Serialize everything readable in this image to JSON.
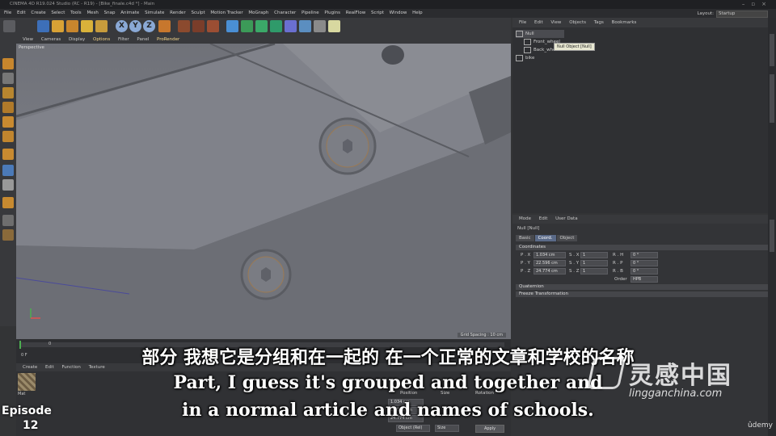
{
  "window": {
    "title": "CINEMA 4D R19.024 Studio (RC - R19) - [Bike_finale.c4d *] - Main"
  },
  "menu": {
    "items": [
      "File",
      "Edit",
      "Create",
      "Select",
      "Tools",
      "Mesh",
      "Snap",
      "Animate",
      "Simulate",
      "Render",
      "Sculpt",
      "Motion Tracker",
      "MoGraph",
      "Character",
      "Pipeline",
      "Plugins",
      "RealFlow",
      "Script",
      "Window",
      "Help"
    ],
    "layout_label": "Layout:",
    "layout_value": "Startup"
  },
  "toolbar": {
    "axis_x": "X",
    "axis_y": "Y",
    "axis_z": "Z"
  },
  "viewport": {
    "menu": [
      "View",
      "Cameras",
      "Display",
      "Options",
      "Filter",
      "Panel",
      "ProRender"
    ],
    "camera_label": "Perspective",
    "grid_spacing": "Grid Spacing : 10 cm"
  },
  "timeline": {
    "frame_start": "0 F",
    "frame_current": "0"
  },
  "material_manager": {
    "menu": [
      "Create",
      "Edit",
      "Function",
      "Texture"
    ],
    "material_name": "Mat",
    "coord_header_position": "Position",
    "coord_header_size": "Size",
    "coord_header_rotation": "Rotation",
    "x_value": "1.034 cm",
    "y_value": "22.596 cm",
    "z_value": "24.774 cm",
    "object_rel": "Object (Rel)",
    "size": "Size",
    "apply": "Apply"
  },
  "object_manager": {
    "menu": [
      "File",
      "Edit",
      "View",
      "Objects",
      "Tags",
      "Bookmarks"
    ],
    "objects": [
      {
        "name": "Null",
        "selected": true
      },
      {
        "name": "Front_wheel",
        "selected": false
      },
      {
        "name": "Back_wheel",
        "selected": false
      },
      {
        "name": "bike",
        "selected": false
      }
    ],
    "tooltip": "Null Object [Null]"
  },
  "attribute_manager": {
    "menu": [
      "Mode",
      "Edit",
      "User Data"
    ],
    "object_header": "Null [Null]",
    "tabs": [
      "Basic",
      "Coord.",
      "Object"
    ],
    "active_tab": "Coord.",
    "section_coordinates": "Coordinates",
    "rows": [
      {
        "p_label": "P . X",
        "p_value": "1.034 cm",
        "s_label": "S . X",
        "s_value": "1",
        "r_label": "R . H",
        "r_value": "0 °"
      },
      {
        "p_label": "P . Y",
        "p_value": "22.596 cm",
        "s_label": "S . Y",
        "s_value": "1",
        "r_label": "R . P",
        "r_value": "0 °"
      },
      {
        "p_label": "P . Z",
        "p_value": "24.774 cm",
        "s_label": "S . Z",
        "s_value": "1",
        "r_label": "R . B",
        "r_value": "0 °"
      }
    ],
    "order_label": "Order",
    "order_value": "HPB",
    "section_quaternion": "Quaternion",
    "section_freeze": "Freeze Transformation"
  },
  "subtitles": {
    "chinese": "部分 我想它是分组和在一起的 在一个正常的文章和学校的名称",
    "english_line1": "Part, I guess it's grouped and together and",
    "english_line2": "in a normal article and names of schools."
  },
  "episode": {
    "label": "Episode",
    "number": "12"
  },
  "watermark": {
    "brand_cn": "灵感中国",
    "url": "lingganchina.com",
    "platform": "ûdemy"
  },
  "colors": {
    "accent_blue": "#8aa9d6",
    "highlight_yellow": "#f5d68a",
    "viewport_gray": "#72747b"
  }
}
